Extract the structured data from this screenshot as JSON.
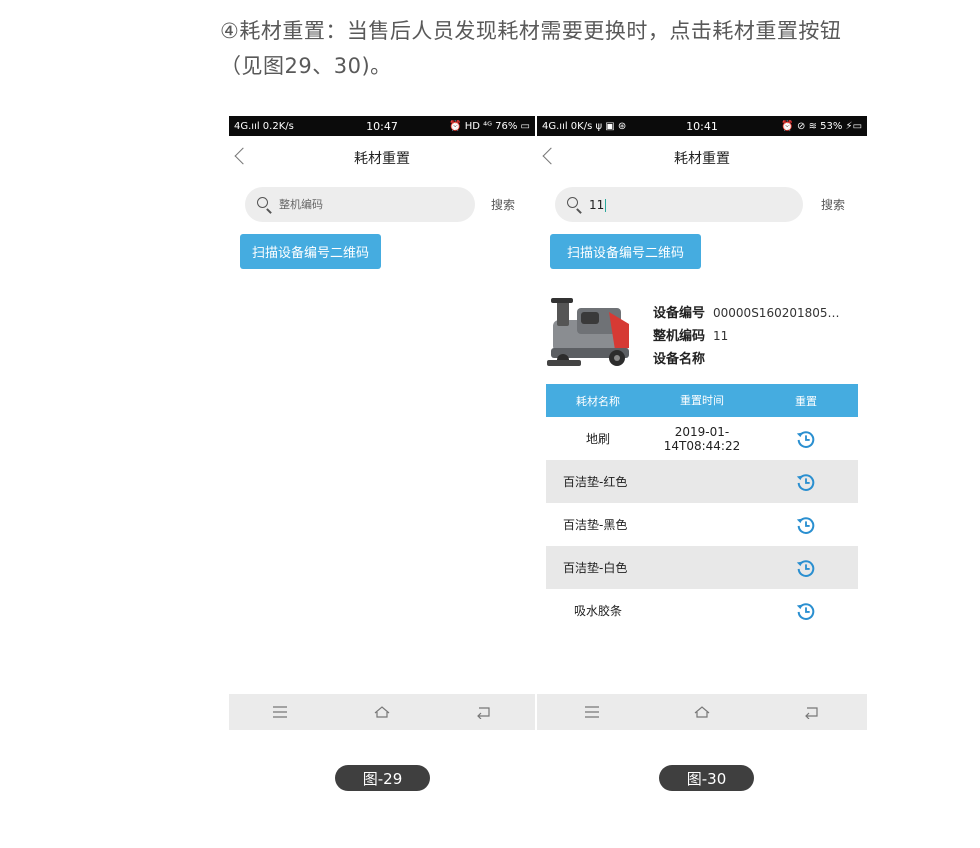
{
  "intro": {
    "line1": "④耗材重置：当售后人员发现耗材需要更换时，点击耗材重置按钮",
    "line2": "（见图29、30)。"
  },
  "phone29": {
    "status": {
      "left": "4G.ııl 0.2K/s",
      "time": "10:47",
      "right": "⏰ HD ⁴ᴳ 76% ▭"
    },
    "title": "耗材重置",
    "search": {
      "placeholder": "整机编码",
      "button": "搜索"
    },
    "scan_button": "扫描设备编号二维码",
    "caption": "图-29"
  },
  "phone30": {
    "status": {
      "left": "4G.ııl 0K/s ψ ▣ ⊛",
      "time": "10:41",
      "right": "⏰ ⊘ ≋ 53% ⚡▭"
    },
    "title": "耗材重置",
    "search": {
      "value": "11",
      "button": "搜索"
    },
    "scan_button": "扫描设备编号二维码",
    "device": {
      "id_label": "设备编号",
      "id_value": "00000S160201805…",
      "code_label": "整机编码",
      "code_value": "11",
      "name_label": "设备名称",
      "name_value": ""
    },
    "table": {
      "headers": [
        "耗材名称",
        "重置时间",
        "重置"
      ],
      "rows": [
        {
          "name": "地刷",
          "time": "2019-01-\n14T08:44:22"
        },
        {
          "name": "百洁垫-红色",
          "time": ""
        },
        {
          "name": "百洁垫-黑色",
          "time": ""
        },
        {
          "name": "百洁垫-白色",
          "time": ""
        },
        {
          "name": "吸水胶条",
          "time": ""
        }
      ]
    },
    "caption": "图-30"
  },
  "colors": {
    "accent": "#45ace0",
    "reset_icon": "#2a8fd0",
    "caption_bg": "#3f3f3f"
  }
}
